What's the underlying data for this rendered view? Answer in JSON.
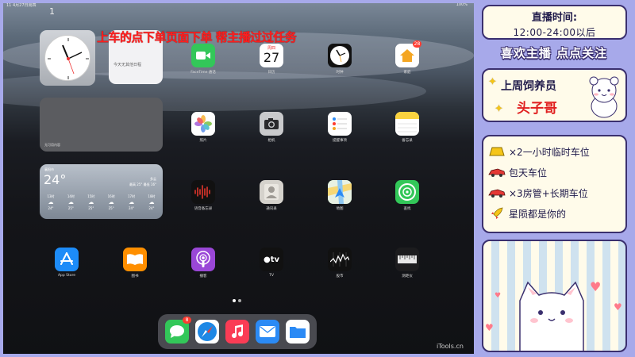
{
  "status_bar": {
    "time": "11  4月27日周四",
    "right": "100%"
  },
  "page_number": "1",
  "banner_text": "上车的点下单页面下单 帮主播过过任务",
  "widgets": {
    "calendar_text": "今天无其他日程",
    "photos_text": "无可用内容",
    "weather": {
      "city": "襄阳市",
      "temp": "24°",
      "condition": "多云",
      "range": "最高 25° 最低 16°",
      "hours": [
        {
          "time": "13时",
          "temp": "24°"
        },
        {
          "time": "14时",
          "temp": "25°"
        },
        {
          "time": "15时",
          "temp": "25°"
        },
        {
          "time": "16时",
          "temp": "25°"
        },
        {
          "time": "17时",
          "temp": "24°"
        },
        {
          "time": "18时",
          "temp": "24°"
        }
      ]
    }
  },
  "apps": [
    {
      "name": "facetime",
      "label": "FaceTime 通话",
      "icon": "video-camera-icon",
      "color": "#33c759"
    },
    {
      "name": "calendar",
      "label": "日历",
      "icon": "calendar-icon",
      "date": "27",
      "color": "#ffffff"
    },
    {
      "name": "clock",
      "label": "时钟",
      "icon": "clock-icon",
      "color": "#000000"
    },
    {
      "name": "home",
      "label": "家庭",
      "icon": "house-icon",
      "badge": "28",
      "color": "#f4a623"
    },
    {
      "name": "photos",
      "label": "照片",
      "icon": "photos-flower-icon",
      "color": "#ffffff"
    },
    {
      "name": "camera",
      "label": "相机",
      "icon": "camera-icon",
      "color": "#c9cacc"
    },
    {
      "name": "reminders",
      "label": "提醒事项",
      "icon": "list-icon",
      "color": "#ffffff"
    },
    {
      "name": "notes",
      "label": "备忘录",
      "icon": "notes-icon",
      "color": "#ffffff"
    },
    {
      "name": "voice-memos",
      "label": "语音备忘录",
      "icon": "waveform-icon",
      "color": "#111111"
    },
    {
      "name": "contacts",
      "label": "通讯录",
      "icon": "contact-icon",
      "color": "#d5d2cc"
    },
    {
      "name": "maps",
      "label": "地图",
      "icon": "map-icon",
      "color": "#6ac17a"
    },
    {
      "name": "find-my",
      "label": "查找",
      "icon": "radar-icon",
      "color": "#33c759"
    },
    {
      "name": "app-store",
      "label": "App Store",
      "icon": "app-store-icon",
      "color": "#1d8cf8"
    },
    {
      "name": "books",
      "label": "图书",
      "icon": "book-icon",
      "color": "#ff8f00"
    },
    {
      "name": "podcasts",
      "label": "播客",
      "icon": "podcast-icon",
      "color": "#9a47d7"
    },
    {
      "name": "tv",
      "label": "TV",
      "icon": "apple-tv-icon",
      "color": "#111111"
    },
    {
      "name": "stocks",
      "label": "股市",
      "icon": "stocks-chart-icon",
      "color": "#111111"
    },
    {
      "name": "measure",
      "label": "测距仪",
      "icon": "ruler-icon",
      "color": "#1c1c1e"
    }
  ],
  "dock": [
    {
      "name": "messages",
      "icon": "message-bubble-icon",
      "badge": "8",
      "color": "#33c759"
    },
    {
      "name": "safari",
      "icon": "compass-icon",
      "color": "#1e88e5"
    },
    {
      "name": "music",
      "icon": "music-note-icon",
      "color": "#fa3c55"
    },
    {
      "name": "mail",
      "icon": "envelope-icon",
      "color": "#2b8af5"
    },
    {
      "name": "files",
      "icon": "folder-icon",
      "color": "#2b8af5"
    }
  ],
  "watermark": "iTools.cn",
  "overlay": {
    "time_title": "直播时间:",
    "time_range": "12:00-24:00以后",
    "follow_text": "喜欢主播 点点关注",
    "feeder_title": "上周饲养员",
    "feeder_name": "头子哥",
    "perks": [
      {
        "icon": "gold-bar-icon",
        "text": "×2一小时临时车位"
      },
      {
        "icon": "red-car-icon",
        "text": "包天车位"
      },
      {
        "icon": "red-car-icon",
        "text": "×3房管+长期车位"
      },
      {
        "icon": "rocket-icon",
        "text": "星陨都是你的"
      }
    ]
  },
  "colors": {
    "overlay_bg": "#a7a9ea",
    "card_bg": "#fffbea",
    "card_border": "#3a2f6e",
    "banner": "#ff1e1e",
    "feeder_name": "#e01f1f"
  }
}
